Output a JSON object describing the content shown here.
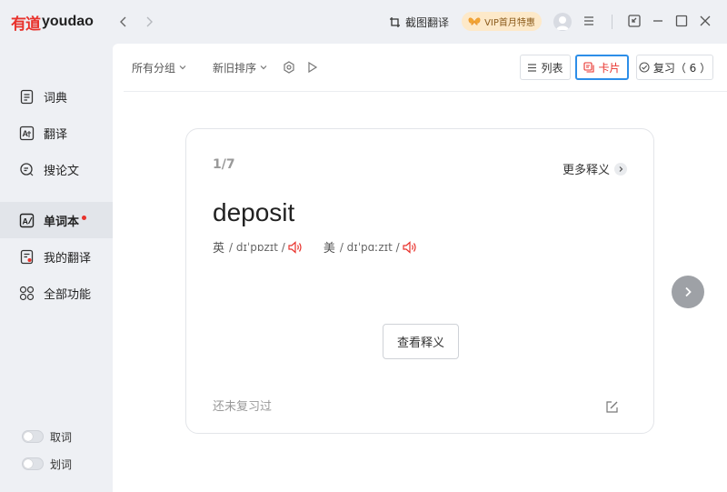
{
  "app": {
    "logo_cn": "有道",
    "logo_en": "youdao"
  },
  "titlebar": {
    "screenshot_translate": "截图翻译",
    "vip_badge": "VIP首月特惠"
  },
  "sidebar": {
    "items": [
      {
        "label": "词典",
        "icon": "dictionary-icon"
      },
      {
        "label": "翻译",
        "icon": "translate-icon"
      },
      {
        "label": "搜论文",
        "icon": "search-paper-icon"
      },
      {
        "label": "单词本",
        "icon": "wordbook-icon",
        "active": true,
        "dot": true
      },
      {
        "label": "我的翻译",
        "icon": "my-translation-icon"
      },
      {
        "label": "全部功能",
        "icon": "all-features-icon"
      }
    ],
    "toggles": [
      {
        "label": "取词",
        "on": false
      },
      {
        "label": "划词",
        "on": false
      }
    ]
  },
  "toolbar": {
    "group_filter": "所有分组",
    "sort_filter": "新旧排序",
    "list_label": "列表",
    "card_label": "卡片",
    "review_label": "复习（ 6 ）"
  },
  "card": {
    "counter": "1/7",
    "more_definitions": "更多释义",
    "word": "deposit",
    "uk_label": "英",
    "uk_phonetic": "/ dɪˈpɒzɪt /",
    "us_label": "美",
    "us_phonetic": "/ dɪˈpɑːzɪt /",
    "view_meaning": "查看释义",
    "status": "还未复习过"
  },
  "colors": {
    "accent_red": "#e8322c",
    "focus_blue": "#2d8ee8",
    "vip_bg": "#fde9c9"
  }
}
